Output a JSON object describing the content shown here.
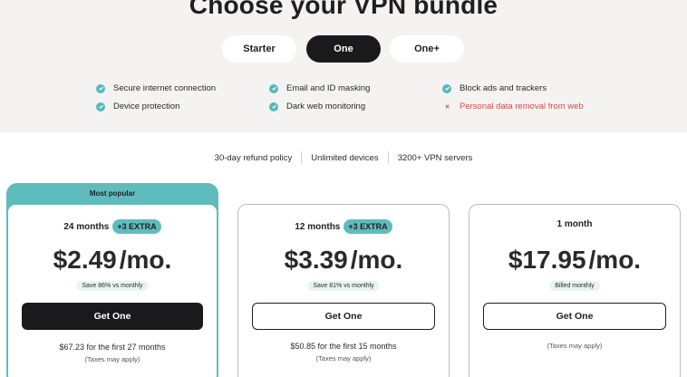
{
  "header": {
    "title": "Choose your VPN bundle"
  },
  "tabs": [
    {
      "label": "Starter",
      "active": false
    },
    {
      "label": "One",
      "active": true
    },
    {
      "label": "One+",
      "active": false
    }
  ],
  "features": [
    {
      "label": "Secure internet connection",
      "included": true
    },
    {
      "label": "Device protection",
      "included": true
    },
    {
      "label": "Email and ID masking",
      "included": true
    },
    {
      "label": "Dark web monitoring",
      "included": true
    },
    {
      "label": "Block ads and trackers",
      "included": true
    },
    {
      "label": "Personal data removal from web",
      "included": false
    }
  ],
  "perks": [
    "30-day refund policy",
    "Unlimited devices",
    "3200+ VPN servers"
  ],
  "plans": [
    {
      "badge": "Most popular",
      "duration": "24 months",
      "extra": "+3 EXTRA",
      "price": "$2.49",
      "unit": "/mo.",
      "save": "Save 86% vs monthly",
      "button": "Get One",
      "total": "$67.23 for the first 27 months",
      "tax": "(Taxes may apply)"
    },
    {
      "duration": "12 months",
      "extra": "+3 EXTRA",
      "price": "$3.39",
      "unit": "/mo.",
      "save": "Save 81% vs monthly",
      "button": "Get One",
      "total": "$50.85 for the first 15 months",
      "tax": "(Taxes may apply)"
    },
    {
      "duration": "1 month",
      "price": "$17.95",
      "unit": "/mo.",
      "save": "Billed monthly",
      "button": "Get One",
      "tax": "(Taxes may apply)"
    }
  ],
  "colors": {
    "accent": "#5fbcbd",
    "dark": "#1a1a1c",
    "negative": "#d94b4b",
    "band": "#f4f3f2"
  }
}
